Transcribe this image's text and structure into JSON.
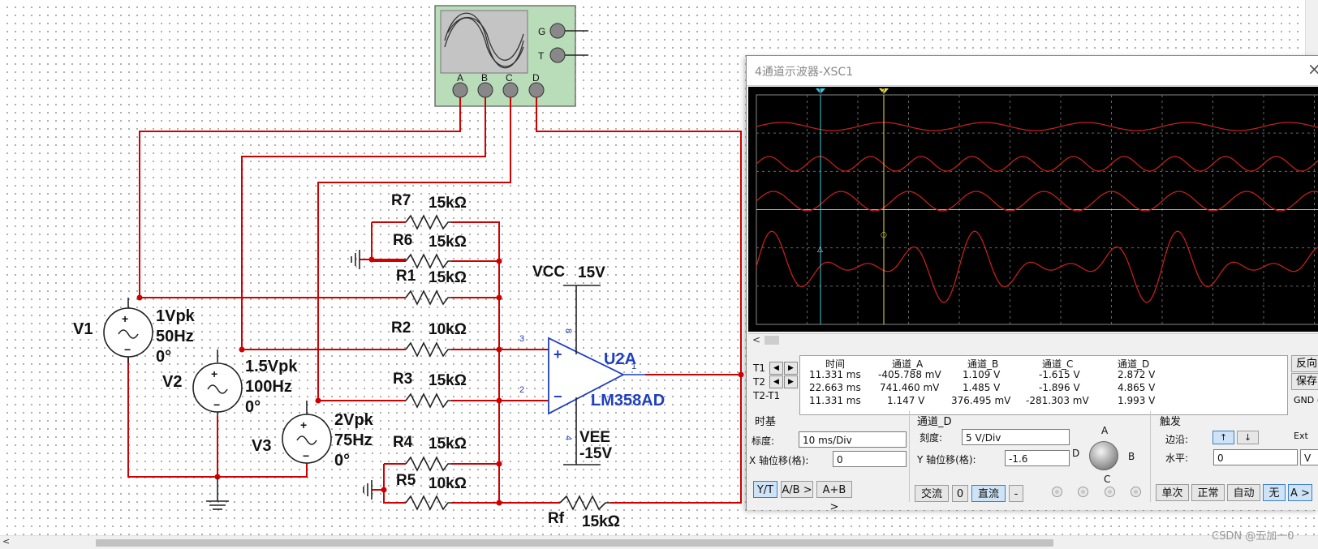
{
  "circuit": {
    "sources": {
      "v1": {
        "name": "V1",
        "amplitude": "1Vpk",
        "frequency": "50Hz",
        "phase": "0°"
      },
      "v2": {
        "name": "V2",
        "amplitude": "1.5Vpk",
        "frequency": "100Hz",
        "phase": "0°"
      },
      "v3": {
        "name": "V3",
        "amplitude": "2Vpk",
        "frequency": "75Hz",
        "phase": "0°"
      }
    },
    "resistors": {
      "r7": {
        "name": "R7",
        "value": "15kΩ"
      },
      "r6": {
        "name": "R6",
        "value": "15kΩ"
      },
      "r1": {
        "name": "R1",
        "value": "15kΩ"
      },
      "r2": {
        "name": "R2",
        "value": "10kΩ"
      },
      "r3": {
        "name": "R3",
        "value": "15kΩ"
      },
      "r4": {
        "name": "R4",
        "value": "15kΩ"
      },
      "r5": {
        "name": "R5",
        "value": "10kΩ"
      },
      "rf": {
        "name": "Rf",
        "value": "15kΩ"
      }
    },
    "opamp": {
      "ref": "U2A",
      "part": "LM358AD",
      "pin_plus": "3",
      "pin_minus": "2",
      "pin_out": "1",
      "pin_vcc": "8",
      "pin_vee": "4"
    },
    "vcc": {
      "name": "VCC",
      "value": "15V"
    },
    "vee": {
      "name": "VEE",
      "value": "-15V"
    },
    "scope_symbol": {
      "channels": [
        "A",
        "B",
        "C",
        "D"
      ],
      "g": "G",
      "t": "T"
    }
  },
  "oscilloscope": {
    "title": "4通道示波器-XSC1",
    "cursor1_label": "1",
    "cursor2_label": "2",
    "readout": {
      "headers": [
        "时间",
        "通道_A",
        "通道_B",
        "通道_C",
        "通道_D"
      ],
      "rows": [
        {
          "label": "T1",
          "time": "11.331 ms",
          "a": "-405.788 mV",
          "b": "1.109 V",
          "c": "-1.615 V",
          "d": "2.872 V"
        },
        {
          "label": "T2",
          "time": "22.663 ms",
          "a": "741.460 mV",
          "b": "1.485 V",
          "c": "-1.896 V",
          "d": "4.865 V"
        },
        {
          "label": "T2-T1",
          "time": "11.331 ms",
          "a": "1.147 V",
          "b": "376.495 mV",
          "c": "-281.303 mV",
          "d": "1.993 V"
        }
      ],
      "side_buttons": [
        "反向",
        "保存"
      ],
      "gnd_label": "GND ("
    },
    "timebase": {
      "title": "时基",
      "scale_label": "标度:",
      "scale_value": "10 ms/Div",
      "xpos_label": "X 轴位移(格):",
      "xpos_value": "0",
      "modes": [
        "Y/T",
        "A/B >",
        "A+B >"
      ]
    },
    "channel": {
      "title": "通道_D",
      "scale_label": "刻度:",
      "scale_value": "5  V/Div",
      "ypos_label": "Y 轴位移(格):",
      "ypos_value": "-1.6",
      "coupling": [
        "交流",
        "0",
        "直流",
        "-"
      ],
      "knob_labels": [
        "A",
        "B",
        "C",
        "D"
      ]
    },
    "trigger": {
      "title": "触发",
      "edge_label": "边沿:",
      "ext_label": "Ext",
      "level_label": "水平:",
      "level_value": "0",
      "level_unit": "V",
      "edge_rise": "↑",
      "edge_fall": "↓",
      "modes": [
        "单次",
        "正常",
        "自动",
        "无",
        "A >"
      ]
    }
  },
  "watermark": "CSDN @五加一0",
  "colors": {
    "wire": "#d10000",
    "trace": "#c0201a",
    "cursor1": "#40c8e0",
    "cursor2": "#e8e040",
    "accent_blue": "#1f3fbf"
  }
}
